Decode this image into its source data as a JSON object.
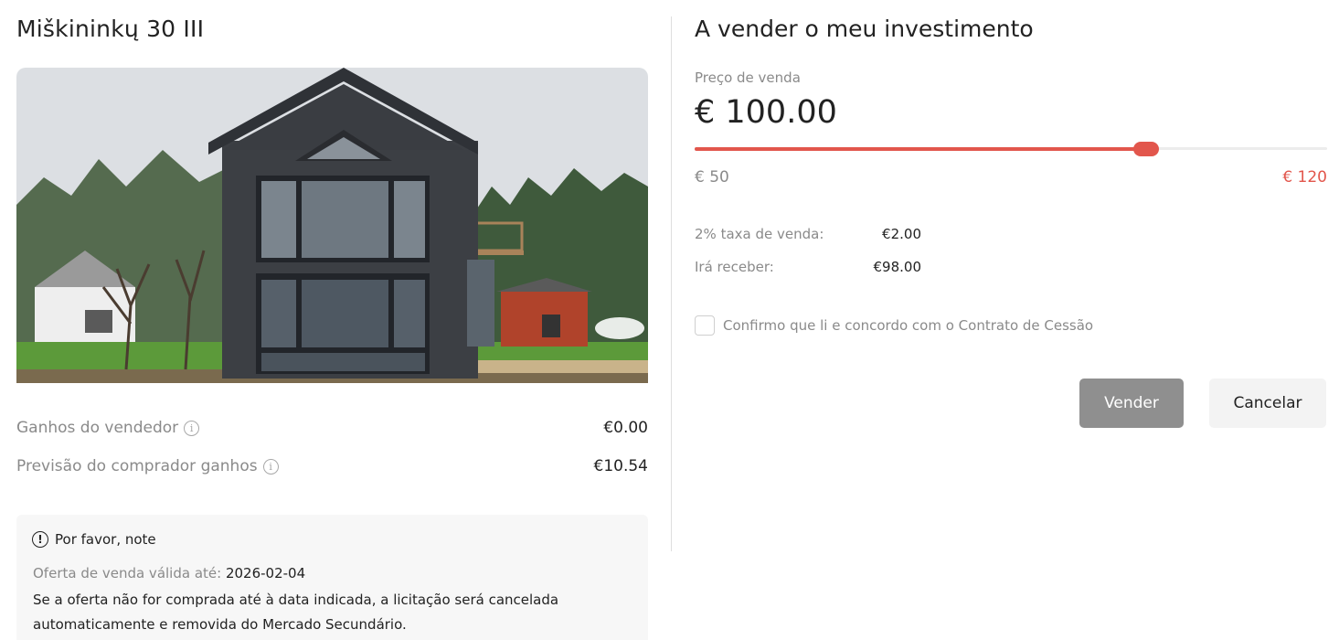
{
  "property": {
    "title": "Miškininkų 30 III",
    "image_alt": "house-photo"
  },
  "stats": {
    "seller_earnings_label": "Ganhos do vendedor",
    "seller_earnings_value": "€0.00",
    "buyer_forecast_label": "Previsão do comprador ganhos",
    "buyer_forecast_value": "€10.54"
  },
  "note": {
    "heading": "Por favor, note",
    "valid_label": "Oferta de venda válida até:",
    "valid_date": "2026-02-04",
    "text": "Se a oferta não for comprada até à data indicada, a licitação será cancelada automaticamente e removida do Mercado Secundário."
  },
  "sell": {
    "title": "A vender o meu investimento",
    "price_label": "Preço de venda",
    "price_value": "€ 100.00",
    "slider": {
      "min": 50,
      "max": 120,
      "value": 100
    },
    "min_label": "€ 50",
    "max_label": "€ 120",
    "fee_label": "2% taxa de venda:",
    "fee_value": "€2.00",
    "receive_label": "Irá receber:",
    "receive_value": "€98.00",
    "confirm_label": "Confirmo que li e concordo com o Contrato de Cessão",
    "confirm_checked": false,
    "sell_button": "Vender",
    "cancel_button": "Cancelar"
  },
  "colors": {
    "accent": "#e2564c",
    "muted_text": "#8a8a8a",
    "sell_button_bg": "#8f8f8f"
  },
  "icons": {
    "info": "info-circle-icon",
    "warning": "exclamation-circle-icon"
  }
}
